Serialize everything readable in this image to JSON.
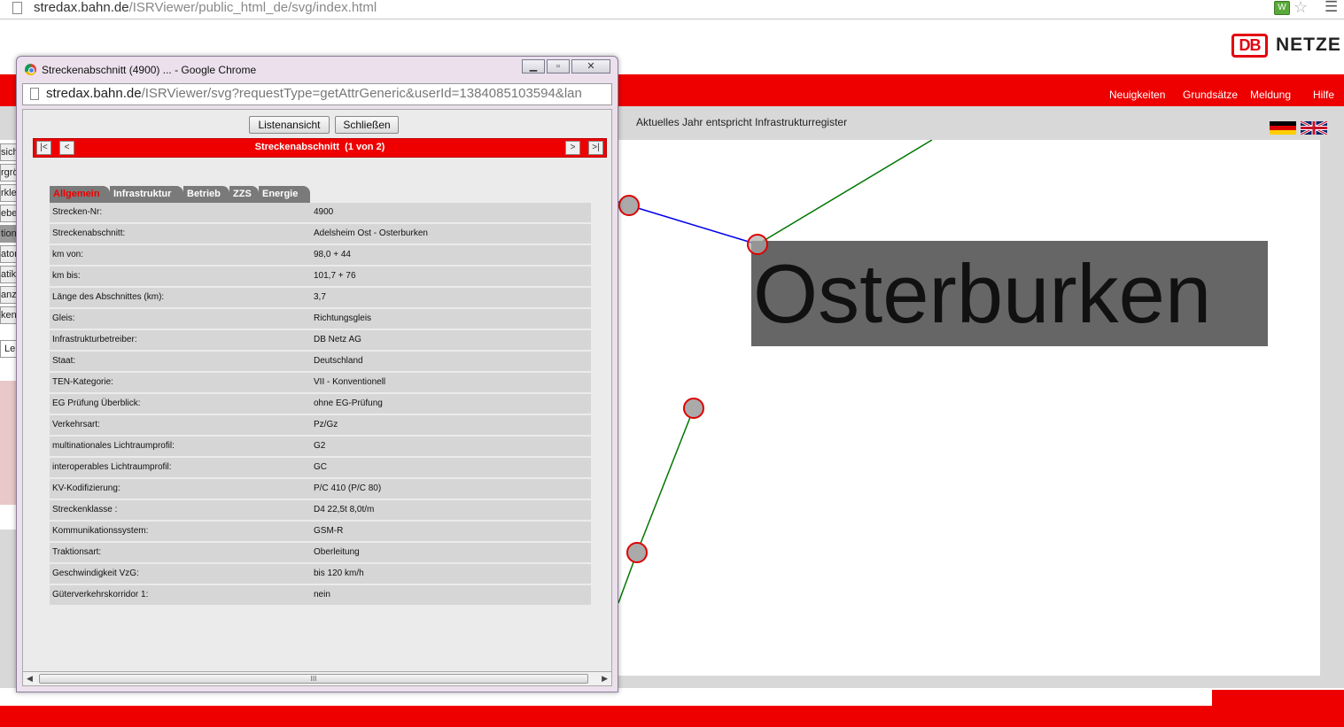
{
  "browser": {
    "url_host": "stredax.bahn.de",
    "url_path": "/ISRViewer/public_html_de/svg/index.html"
  },
  "header": {
    "logo_db": "DB",
    "logo_netze": "NETZE"
  },
  "nav": {
    "items": [
      "Neuigkeiten",
      "Grundsätze",
      "Meldung",
      "Hilfe"
    ]
  },
  "info_text": "Aktuelles Jahr entspricht Infrastrukturregister",
  "sidebar": {
    "items": [
      "sich",
      "rgrö",
      "rkle",
      "ebe",
      "tion",
      "ator",
      "atik",
      "anz",
      "ken",
      "Le"
    ]
  },
  "map": {
    "station_label": "Osterburken"
  },
  "popup": {
    "window_title": "Streckenabschnitt (4900) ... - Google Chrome",
    "url_host": "stredax.bahn.de",
    "url_path": "/ISRViewer/svg?requestType=getAttrGeneric&userId=1384085103594&lan",
    "list_view_button": "Listenansicht",
    "close_button": "Schließen",
    "pager": {
      "title": "Streckenabschnitt  (1 von 2)",
      "first": "|<",
      "prev": "<",
      "next": ">",
      "last": ">|"
    },
    "tabs": [
      "Allgemein",
      "Infrastruktur",
      "Betrieb",
      "ZZS",
      "Energie"
    ],
    "active_tab": "Allgemein",
    "attributes": [
      {
        "key": "Strecken-Nr:",
        "value": "4900"
      },
      {
        "key": "Streckenabschnitt:",
        "value": "Adelsheim Ost - Osterburken"
      },
      {
        "key": "km von:",
        "value": "98,0 + 44"
      },
      {
        "key": "km bis:",
        "value": "101,7 + 76"
      },
      {
        "key": "Länge des Abschnittes (km):",
        "value": "3,7"
      },
      {
        "key": "Gleis:",
        "value": "Richtungsgleis"
      },
      {
        "key": "Infrastrukturbetreiber:",
        "value": "DB Netz AG"
      },
      {
        "key": "Staat:",
        "value": "Deutschland"
      },
      {
        "key": "TEN-Kategorie:",
        "value": "VII - Konventionell"
      },
      {
        "key": "EG Prüfung Überblick:",
        "value": "ohne EG-Prüfung"
      },
      {
        "key": "Verkehrsart:",
        "value": "Pz/Gz"
      },
      {
        "key": "multinationales Lichtraumprofil:",
        "value": "G2"
      },
      {
        "key": "interoperables Lichtraumprofil:",
        "value": "GC"
      },
      {
        "key": "KV-Kodifizierung:",
        "value": "P/C 410 (P/C 80)"
      },
      {
        "key": "Streckenklasse :",
        "value": "D4 22,5t 8,0t/m"
      },
      {
        "key": "Kommunikationssystem:",
        "value": "GSM-R"
      },
      {
        "key": "Traktionsart:",
        "value": "Oberleitung"
      },
      {
        "key": "Geschwindigkeit VzG:",
        "value": "bis 120 km/h"
      },
      {
        "key": "Güterverkehrskorridor 1:",
        "value": "nein"
      }
    ],
    "scroll_grip": "III"
  },
  "colors": {
    "db_red": "#ee0000",
    "track_blue": "#0000ee",
    "track_green": "#007700"
  }
}
